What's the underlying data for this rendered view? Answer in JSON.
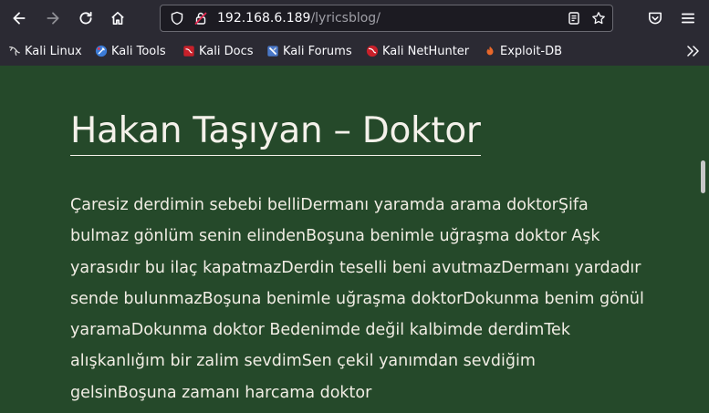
{
  "browser": {
    "url_host": "192.168.6.189",
    "url_path": "/lyricsblog/",
    "bookmarks": [
      {
        "label": "Kali Linux",
        "icon": "kali-dragon-icon"
      },
      {
        "label": "Kali Tools",
        "icon": "kali-tools-icon"
      },
      {
        "label": "Kali Docs",
        "icon": "kali-docs-icon"
      },
      {
        "label": "Kali Forums",
        "icon": "kali-forums-icon"
      },
      {
        "label": "Kali NetHunter",
        "icon": "kali-nethunter-icon"
      },
      {
        "label": "Exploit-DB",
        "icon": "exploit-db-icon"
      }
    ]
  },
  "page": {
    "title": "Hakan Taşıyan – Doktor",
    "body": "Çaresiz derdimin sebebi belliDermanı yaramda arama doktorŞifa bulmaz gönlüm senin elindenBoşuna benimle uğraşma doktor Aşk yarasıdır bu ilaç kapatmazDerdin teselli beni avutmazDermanı yardadır sende bulunmazBoşuna benimle uğraşma doktorDokunma benim gönül yaramaDokunma doktor Bedenimde değil kalbimde derdimTek alışkanlığım bir zalim sevdimSen çekil yanımdan sevdiğim gelsinBoşuna zamanı harcama doktor"
  },
  "colors": {
    "page_background": "#25492a",
    "text": "#f1ede4",
    "chrome": "#2b2a33"
  }
}
